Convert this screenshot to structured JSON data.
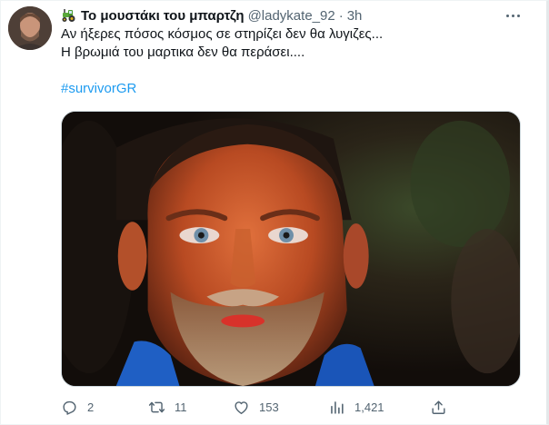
{
  "tweet": {
    "display_name": "Το μουστάκι του μπαρτζη",
    "handle": "@ladykate_92",
    "separator": "·",
    "time": "3h",
    "lines": [
      "Αν ήξερες πόσος κόσμος σε στηρίζει δεν θα λυγιζες...",
      "Η βρωμιά του μαρτικα δεν θα περάσει...."
    ],
    "hashtag": "#survivorGR",
    "media_alt": "Close-up of a bearded man with tearful blue eyes, face lit in orange light against a dark jungle background",
    "icons": {
      "name_emoji": "tractor-icon",
      "more": "more-icon",
      "reply": "reply-icon",
      "retweet": "retweet-icon",
      "like": "like-icon",
      "views": "views-icon",
      "share": "share-icon"
    }
  },
  "actions": {
    "reply_count": "2",
    "retweet_count": "11",
    "like_count": "153",
    "views_count": "1,421"
  },
  "colors": {
    "text": "#0f1419",
    "secondary": "#536471",
    "link": "#1d9bf0",
    "border": "#cfd9de"
  }
}
